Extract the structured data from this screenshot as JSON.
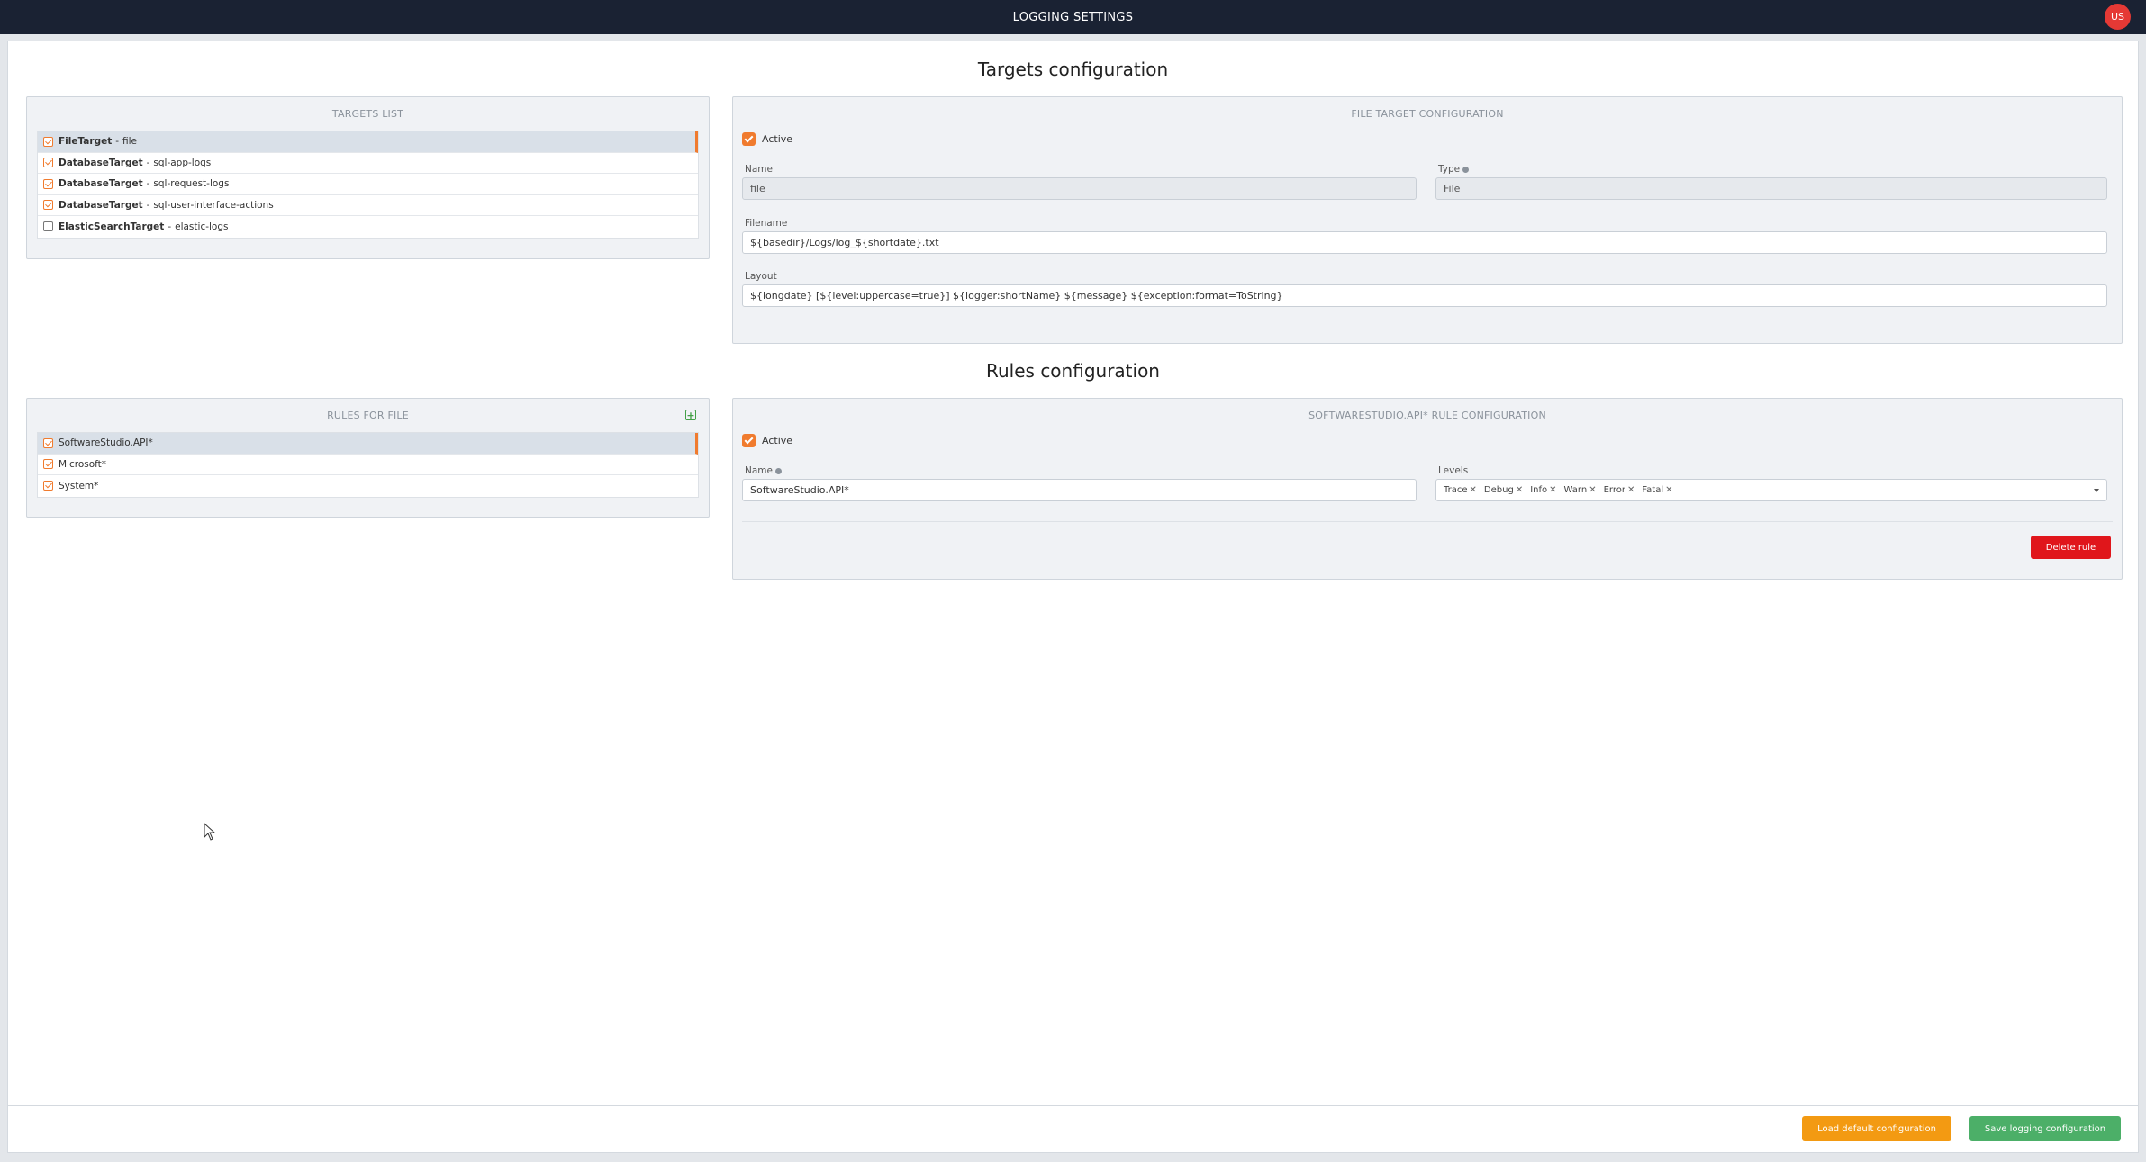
{
  "topbar": {
    "title": "LOGGING SETTINGS",
    "avatar_initials": "US"
  },
  "targets_section": {
    "title": "Targets configuration"
  },
  "targets_list": {
    "header": "TARGETS LIST",
    "items": [
      {
        "type": "FileTarget",
        "sep": "-",
        "name": "file",
        "checked": true,
        "selected": true
      },
      {
        "type": "DatabaseTarget",
        "sep": "-",
        "name": "sql-app-logs",
        "checked": true,
        "selected": false
      },
      {
        "type": "DatabaseTarget",
        "sep": "-",
        "name": "sql-request-logs",
        "checked": true,
        "selected": false
      },
      {
        "type": "DatabaseTarget",
        "sep": "-",
        "name": "sql-user-interface-actions",
        "checked": true,
        "selected": false
      },
      {
        "type": "ElasticSearchTarget",
        "sep": "-",
        "name": "elastic-logs",
        "checked": false,
        "selected": false
      }
    ]
  },
  "file_target_config": {
    "header": "FILE TARGET CONFIGURATION",
    "active_label": "Active",
    "name_label": "Name",
    "name_value": "file",
    "type_label": "Type",
    "type_value": "File",
    "filename_label": "Filename",
    "filename_value": "${basedir}/Logs/log_${shortdate}.txt",
    "layout_label": "Layout",
    "layout_value": "${longdate} [${level:uppercase=true}] ${logger:shortName} ${message} ${exception:format=ToString}"
  },
  "rules_section": {
    "title": "Rules configuration"
  },
  "rules_list": {
    "header": "RULES FOR FILE",
    "items": [
      {
        "name": "SoftwareStudio.API*",
        "checked": true,
        "selected": true
      },
      {
        "name": "Microsoft*",
        "checked": true,
        "selected": false
      },
      {
        "name": "System*",
        "checked": true,
        "selected": false
      }
    ]
  },
  "rule_config": {
    "header": "SOFTWARESTUDIO.API* RULE CONFIGURATION",
    "active_label": "Active",
    "name_label": "Name",
    "name_value": "SoftwareStudio.API*",
    "levels_label": "Levels",
    "levels": [
      "Trace",
      "Debug",
      "Info",
      "Warn",
      "Error",
      "Fatal"
    ],
    "delete_label": "Delete rule"
  },
  "footer": {
    "load_default_label": "Load default configuration",
    "save_label": "Save logging configuration"
  },
  "colors": {
    "topbar": "#1a2233",
    "accent": "#f07b2e",
    "danger": "#e0161b",
    "warning": "#f39a12",
    "success": "#4caf68"
  }
}
